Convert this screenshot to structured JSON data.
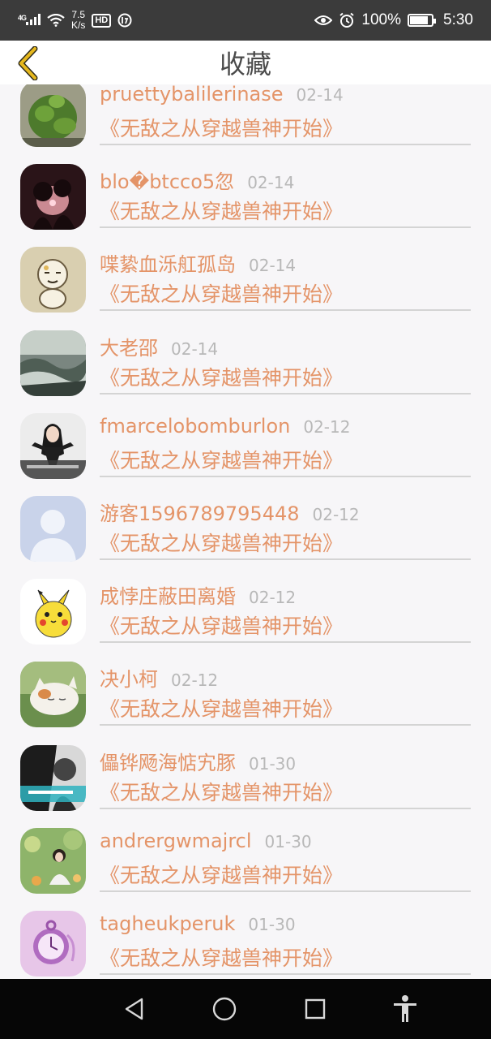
{
  "status_bar": {
    "signal": "4G",
    "speed_value": "7.5",
    "speed_unit": "K/s",
    "hd": "HD",
    "battery_percent": "100%",
    "time": "5:30"
  },
  "header": {
    "title": "收藏",
    "accent_color": "#e6b81e"
  },
  "colors": {
    "name": "#e49468",
    "date": "#b8b8b8",
    "divider": "#d4d4d4"
  },
  "favorites": [
    {
      "name": "pruettybalilerinase",
      "date": "02-14",
      "book": "《无敌之从穿越兽神开始》",
      "avatar": "plant-avatar"
    },
    {
      "name": "blo�btcco5忽",
      "date": "02-14",
      "book": "《无敌之从穿越兽神开始》",
      "avatar": "couple-avatar"
    },
    {
      "name": "喋絷血泺舡孤岛",
      "date": "02-14",
      "book": "《无敌之从穿越兽神开始》",
      "avatar": "cartoon-avatar"
    },
    {
      "name": "大老邵",
      "date": "02-14",
      "book": "《无敌之从穿越兽神开始》",
      "avatar": "landscape-avatar"
    },
    {
      "name": "fmarcelobomburlon",
      "date": "02-12",
      "book": "《无敌之从穿越兽神开始》",
      "avatar": "woman-avatar"
    },
    {
      "name": "游客1596789795448",
      "date": "02-12",
      "book": "《无敌之从穿越兽神开始》",
      "avatar": "default-avatar"
    },
    {
      "name": "成悖庄蔽田离婚",
      "date": "02-12",
      "book": "《无敌之从穿越兽神开始》",
      "avatar": "pikachu-avatar"
    },
    {
      "name": "决小柯",
      "date": "02-12",
      "book": "《无敌之从穿越兽神开始》",
      "avatar": "cat-avatar"
    },
    {
      "name": "儡铧飏海惦宄豚",
      "date": "01-30",
      "book": "《无敌之从穿越兽神开始》",
      "avatar": "bw-photo-avatar"
    },
    {
      "name": "andrergwmajrcl",
      "date": "01-30",
      "book": "《无敌之从穿越兽神开始》",
      "avatar": "girl-garden-avatar"
    },
    {
      "name": "tagheukperuk",
      "date": "01-30",
      "book": "《无敌之从穿越兽神开始》",
      "avatar": "pocket-watch-avatar"
    }
  ],
  "nav": {
    "back": "back-triangle-icon",
    "home": "home-circle-icon",
    "recents": "recents-square-icon",
    "accessibility": "accessibility-icon"
  }
}
